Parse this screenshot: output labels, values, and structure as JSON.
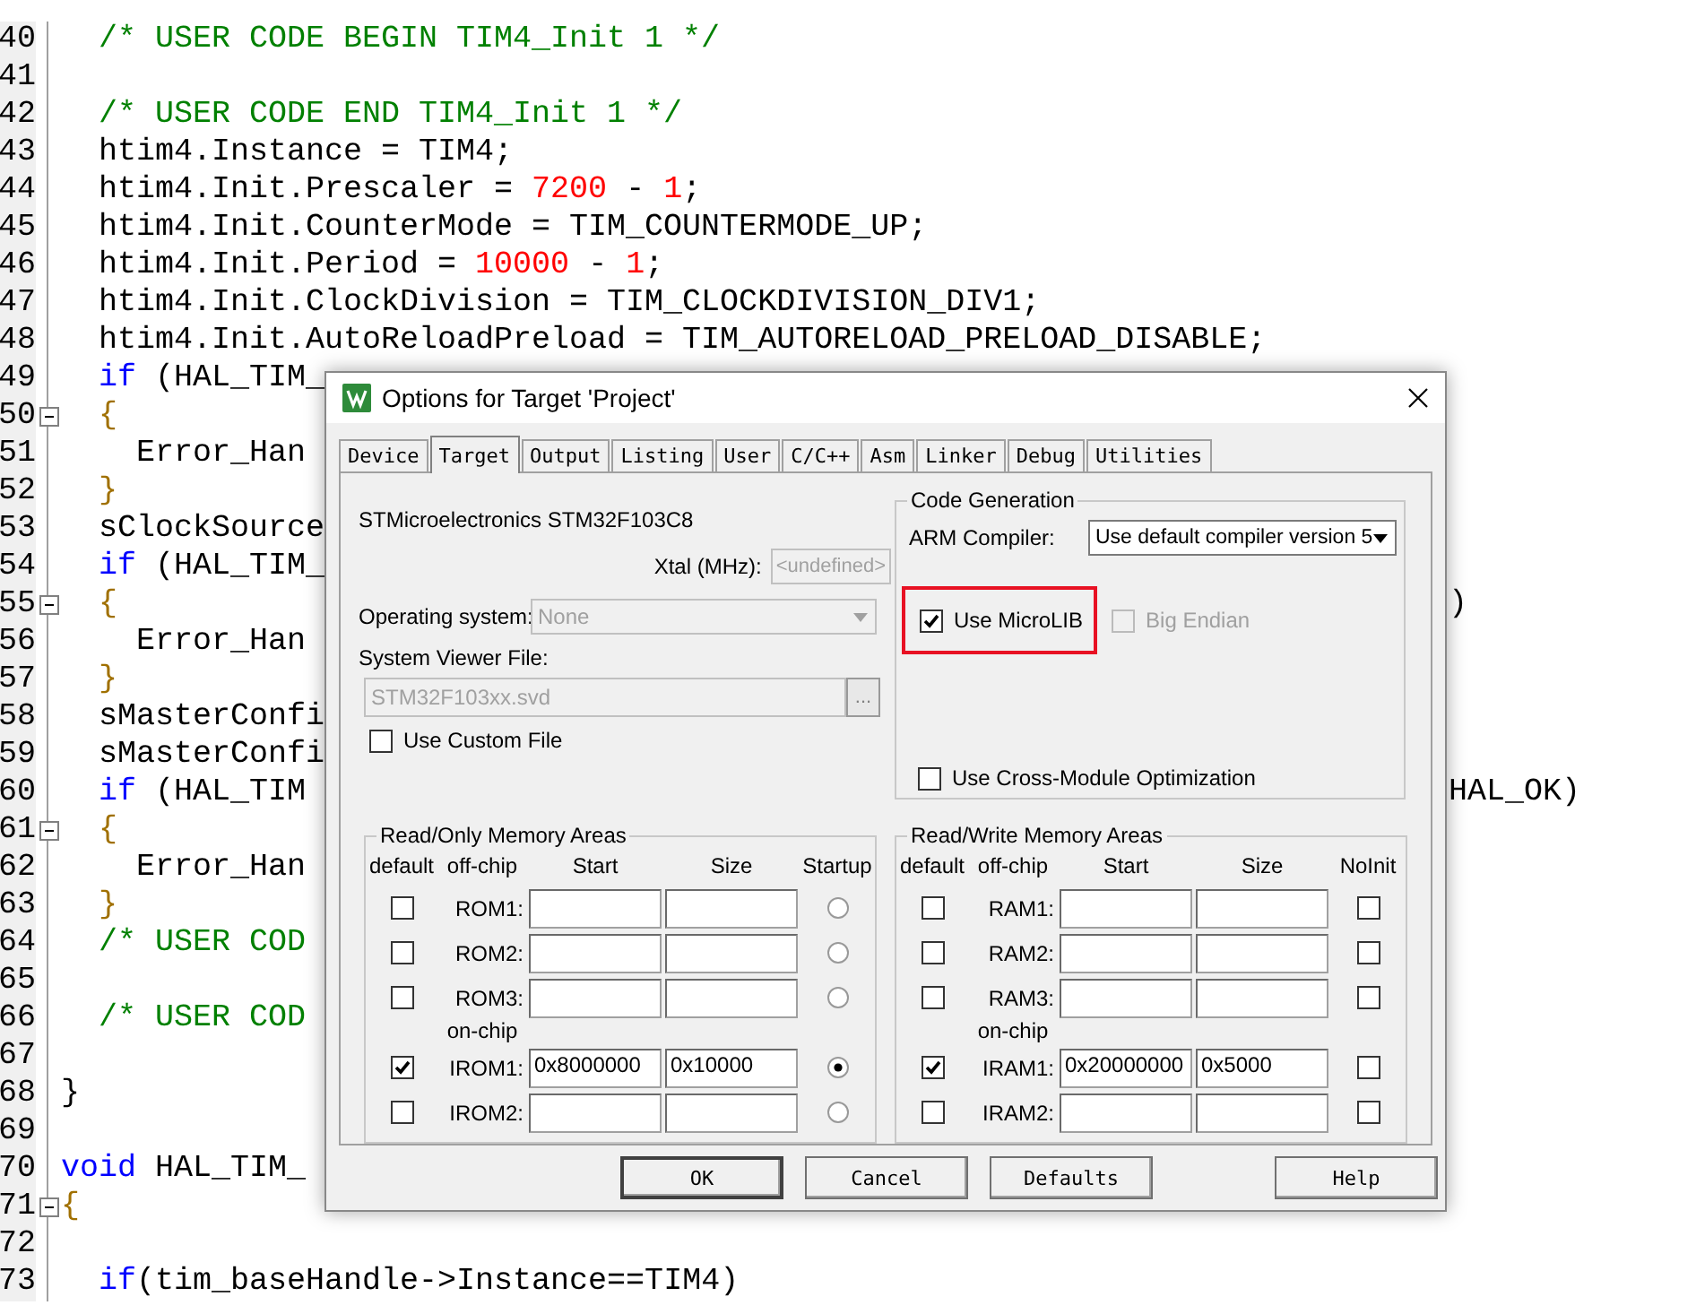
{
  "editor": {
    "lines": [
      {
        "number": "40",
        "fold": false,
        "tokens": [
          {
            "kind": "comment",
            "text": "  /* USER CODE BEGIN TIM4_Init 1 */"
          }
        ]
      },
      {
        "number": "41",
        "fold": false
      },
      {
        "number": "42",
        "fold": false,
        "tokens": [
          {
            "kind": "comment",
            "text": "  /* USER CODE END TIM4_Init 1 */"
          }
        ]
      },
      {
        "number": "43",
        "fold": false,
        "tokens": [
          {
            "kind": "plain",
            "text": "  htim4.Instance = TIM4;"
          }
        ]
      },
      {
        "number": "44",
        "fold": false,
        "tokens": [
          {
            "kind": "plain",
            "text": "  htim4.Init.Prescaler = "
          },
          {
            "kind": "number",
            "text": "7200"
          },
          {
            "kind": "plain",
            "text": " - "
          },
          {
            "kind": "number",
            "text": "1"
          },
          {
            "kind": "plain",
            "text": ";"
          }
        ]
      },
      {
        "number": "45",
        "fold": false,
        "tokens": [
          {
            "kind": "plain",
            "text": "  htim4.Init.CounterMode = TIM_COUNTERMODE_UP;"
          }
        ]
      },
      {
        "number": "46",
        "fold": false,
        "tokens": [
          {
            "kind": "plain",
            "text": "  htim4.Init.Period = "
          },
          {
            "kind": "number",
            "text": "10000"
          },
          {
            "kind": "plain",
            "text": " - "
          },
          {
            "kind": "number",
            "text": "1"
          },
          {
            "kind": "plain",
            "text": ";"
          }
        ]
      },
      {
        "number": "47",
        "fold": false,
        "tokens": [
          {
            "kind": "plain",
            "text": "  htim4.Init.ClockDivision = TIM_CLOCKDIVISION_DIV1;"
          }
        ]
      },
      {
        "number": "48",
        "fold": false,
        "tokens": [
          {
            "kind": "plain",
            "text": "  htim4.Init.AutoReloadPreload = TIM_AUTORELOAD_PRELOAD_DISABLE;"
          }
        ]
      },
      {
        "number": "49",
        "fold": false,
        "tokens": [
          {
            "kind": "keyword",
            "text": "  if"
          },
          {
            "kind": "plain",
            "text": " (HAL_TIM_"
          }
        ]
      },
      {
        "number": "50",
        "fold": true,
        "tokens": [
          {
            "kind": "brace",
            "text": "  {"
          }
        ]
      },
      {
        "number": "51",
        "fold": false,
        "tokens": [
          {
            "kind": "plain",
            "text": "    Error_Han"
          }
        ]
      },
      {
        "number": "52",
        "fold": false,
        "tokens": [
          {
            "kind": "brace",
            "text": "  }"
          }
        ]
      },
      {
        "number": "53",
        "fold": false,
        "tokens": [
          {
            "kind": "plain",
            "text": "  sClockSource"
          }
        ]
      },
      {
        "number": "54",
        "fold": false,
        "tokens": [
          {
            "kind": "keyword",
            "text": "  if"
          },
          {
            "kind": "plain",
            "text": " (HAL_TIM_"
          }
        ]
      },
      {
        "number": "55",
        "fold": true,
        "tokens": [
          {
            "kind": "brace",
            "text": "  {"
          }
        ],
        "tail": ")"
      },
      {
        "number": "56",
        "fold": false,
        "tokens": [
          {
            "kind": "plain",
            "text": "    Error_Han"
          }
        ]
      },
      {
        "number": "57",
        "fold": false,
        "tokens": [
          {
            "kind": "brace",
            "text": "  }"
          }
        ]
      },
      {
        "number": "58",
        "fold": false,
        "tokens": [
          {
            "kind": "plain",
            "text": "  sMasterConfi"
          }
        ]
      },
      {
        "number": "59",
        "fold": false,
        "tokens": [
          {
            "kind": "plain",
            "text": "  sMasterConfi"
          }
        ]
      },
      {
        "number": "60",
        "fold": false,
        "tokens": [
          {
            "kind": "keyword",
            "text": "  if"
          },
          {
            "kind": "plain",
            "text": " (HAL_TIM"
          }
        ],
        "tail": "HAL_OK)"
      },
      {
        "number": "61",
        "fold": true,
        "tokens": [
          {
            "kind": "brace",
            "text": "  {"
          }
        ]
      },
      {
        "number": "62",
        "fold": false,
        "tokens": [
          {
            "kind": "plain",
            "text": "    Error_Han"
          }
        ]
      },
      {
        "number": "63",
        "fold": false,
        "tokens": [
          {
            "kind": "brace",
            "text": "  }"
          }
        ]
      },
      {
        "number": "64",
        "fold": false,
        "tokens": [
          {
            "kind": "comment",
            "text": "  /* USER COD"
          }
        ]
      },
      {
        "number": "65",
        "fold": false
      },
      {
        "number": "66",
        "fold": false,
        "tokens": [
          {
            "kind": "comment",
            "text": "  /* USER COD"
          }
        ]
      },
      {
        "number": "67",
        "fold": false
      },
      {
        "number": "68",
        "fold": false,
        "tokens": [
          {
            "kind": "plain",
            "text": "}"
          }
        ]
      },
      {
        "number": "69",
        "fold": false
      },
      {
        "number": "70",
        "fold": false,
        "tokens": [
          {
            "kind": "keyword",
            "text": "void"
          },
          {
            "kind": "plain",
            "text": " HAL_TIM_"
          }
        ]
      },
      {
        "number": "71",
        "fold": true,
        "tokens": [
          {
            "kind": "brace",
            "text": "{"
          }
        ]
      },
      {
        "number": "72",
        "fold": false
      },
      {
        "number": "73",
        "fold": false,
        "tokens": [
          {
            "kind": "keyword",
            "text": "  if"
          },
          {
            "kind": "plain",
            "text": "(tim_baseHandle->Instance==TIM4)"
          }
        ]
      }
    ]
  },
  "dialog": {
    "title": "Options for Target 'Project'",
    "tabs": [
      {
        "label": "Device",
        "selected": false
      },
      {
        "label": "Target",
        "selected": true
      },
      {
        "label": "Output",
        "selected": false
      },
      {
        "label": "Listing",
        "selected": false
      },
      {
        "label": "User",
        "selected": false
      },
      {
        "label": "C/C++",
        "selected": false
      },
      {
        "label": "Asm",
        "selected": false
      },
      {
        "label": "Linker",
        "selected": false
      },
      {
        "label": "Debug",
        "selected": false
      },
      {
        "label": "Utilities",
        "selected": false
      }
    ],
    "device": "STMicroelectronics STM32F103C8",
    "xtal": {
      "label": "Xtal (MHz):",
      "value": "<undefined>",
      "disabled": true
    },
    "os": {
      "label": "Operating system:",
      "value": "None",
      "disabled": true
    },
    "svd": {
      "label": "System Viewer File:",
      "value": "STM32F103xx.svd",
      "disabled": true,
      "browse": "..."
    },
    "custom_file": {
      "label": "Use Custom File",
      "checked": false
    },
    "code_generation": {
      "title": "Code Generation",
      "compiler_label": "ARM Compiler:",
      "compiler_value": "Use default compiler version 5",
      "microlib": {
        "label": "Use MicroLIB",
        "checked": true,
        "highlighted": true
      },
      "big_endian": {
        "label": "Big Endian",
        "checked": false,
        "disabled": true
      },
      "cross_module": {
        "label": "Use Cross-Module Optimization",
        "checked": false
      }
    },
    "rom": {
      "title": "Read/Only Memory Areas",
      "headers": [
        "default",
        "off-chip",
        "Start",
        "Size",
        "Startup"
      ],
      "rows": [
        {
          "kind": "area",
          "label": "ROM1:",
          "default": false,
          "flag": false
        },
        {
          "kind": "area",
          "label": "ROM2:",
          "default": false,
          "flag": false
        },
        {
          "kind": "area",
          "label": "ROM3:",
          "default": false,
          "flag": false
        },
        {
          "kind": "section",
          "label": "on-chip"
        },
        {
          "kind": "area",
          "label": "IROM1:",
          "default": true,
          "start": "0x8000000",
          "size": "0x10000",
          "flag": true
        },
        {
          "kind": "area",
          "label": "IROM2:",
          "default": false,
          "flag": false
        }
      ]
    },
    "ram": {
      "title": "Read/Write Memory Areas",
      "headers": [
        "default",
        "off-chip",
        "Start",
        "Size",
        "NoInit"
      ],
      "rows": [
        {
          "kind": "area",
          "label": "RAM1:",
          "default": false,
          "flag": false
        },
        {
          "kind": "area",
          "label": "RAM2:",
          "default": false,
          "flag": false
        },
        {
          "kind": "area",
          "label": "RAM3:",
          "default": false,
          "flag": false
        },
        {
          "kind": "section",
          "label": "on-chip"
        },
        {
          "kind": "area",
          "label": "IRAM1:",
          "default": true,
          "start": "0x20000000",
          "size": "0x5000",
          "flag": false
        },
        {
          "kind": "area",
          "label": "IRAM2:",
          "default": false,
          "flag": false
        }
      ]
    },
    "buttons": [
      "OK",
      "Cancel",
      "Defaults",
      "Help"
    ]
  }
}
